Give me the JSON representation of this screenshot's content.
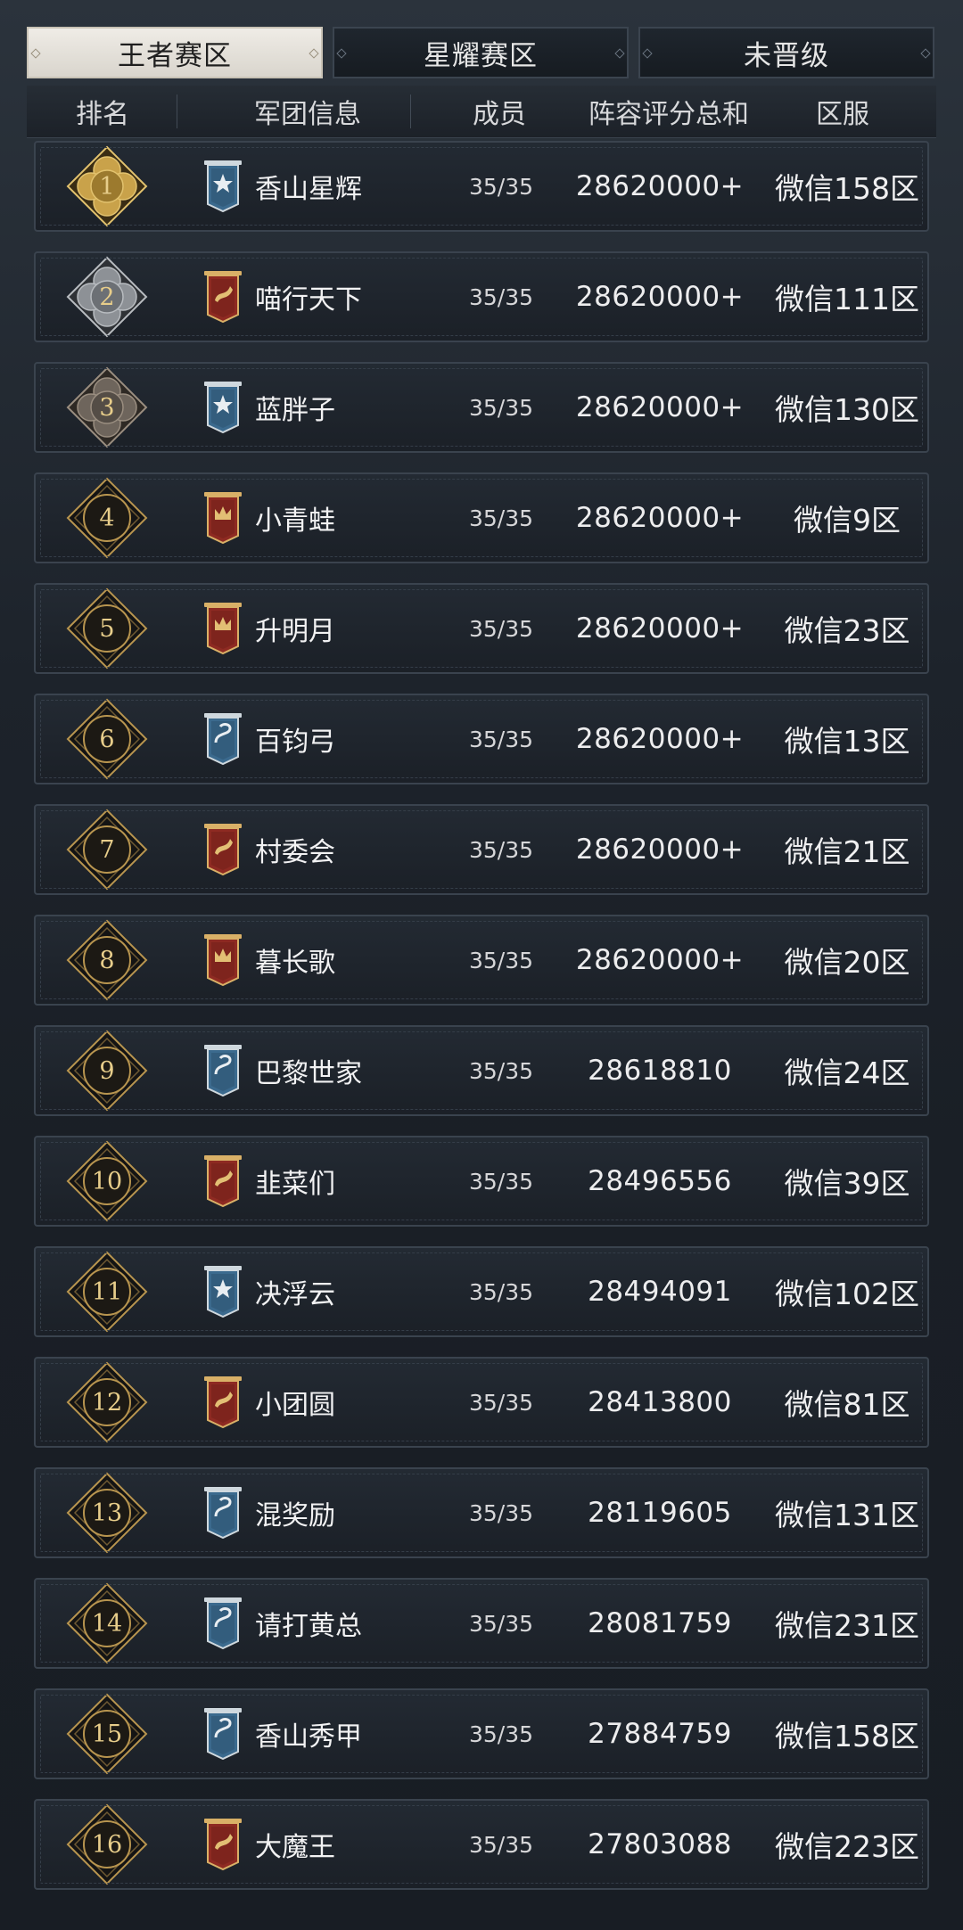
{
  "tabs": [
    {
      "label": "王者赛区",
      "active": true
    },
    {
      "label": "星耀赛区",
      "active": false
    },
    {
      "label": "未晋级",
      "active": false
    }
  ],
  "columns": {
    "rank": "排名",
    "guild": "军团信息",
    "members": "成员",
    "score": "阵容评分总和",
    "server": "区服"
  },
  "colors": {
    "gold_badge": "#c9a24a",
    "silver_badge": "#8d9196",
    "bronze_badge": "#6e655c",
    "red_banner": "#8e2a22",
    "blue_banner": "#3b6a8e"
  },
  "rows": [
    {
      "rank": "1",
      "name": "香山星辉",
      "members": "35/35",
      "score": "28620000+",
      "server": "微信158区",
      "banner": "blue-star",
      "badge": "gold"
    },
    {
      "rank": "2",
      "name": "喵行天下",
      "members": "35/35",
      "score": "28620000+",
      "server": "微信111区",
      "banner": "red-dragon",
      "badge": "silver"
    },
    {
      "rank": "3",
      "name": "蓝胖子",
      "members": "35/35",
      "score": "28620000+",
      "server": "微信130区",
      "banner": "blue-star",
      "badge": "bronze"
    },
    {
      "rank": "4",
      "name": "小青蛙",
      "members": "35/35",
      "score": "28620000+",
      "server": "微信9区",
      "banner": "red-crown",
      "badge": "dark"
    },
    {
      "rank": "5",
      "name": "升明月",
      "members": "35/35",
      "score": "28620000+",
      "server": "微信23区",
      "banner": "red-crown",
      "badge": "dark"
    },
    {
      "rank": "6",
      "name": "百钧弓",
      "members": "35/35",
      "score": "28620000+",
      "server": "微信13区",
      "banner": "blue-serpent",
      "badge": "dark"
    },
    {
      "rank": "7",
      "name": "村委会",
      "members": "35/35",
      "score": "28620000+",
      "server": "微信21区",
      "banner": "red-dragon",
      "badge": "dark"
    },
    {
      "rank": "8",
      "name": "暮长歌",
      "members": "35/35",
      "score": "28620000+",
      "server": "微信20区",
      "banner": "red-crown",
      "badge": "dark"
    },
    {
      "rank": "9",
      "name": "巴黎世家",
      "members": "35/35",
      "score": "28618810",
      "server": "微信24区",
      "banner": "blue-serpent",
      "badge": "dark"
    },
    {
      "rank": "10",
      "name": "韭菜们",
      "members": "35/35",
      "score": "28496556",
      "server": "微信39区",
      "banner": "red-dragon",
      "badge": "dark"
    },
    {
      "rank": "11",
      "name": "决浮云",
      "members": "35/35",
      "score": "28494091",
      "server": "微信102区",
      "banner": "blue-star",
      "badge": "dark"
    },
    {
      "rank": "12",
      "name": "小团圆",
      "members": "35/35",
      "score": "28413800",
      "server": "微信81区",
      "banner": "red-dragon",
      "badge": "dark"
    },
    {
      "rank": "13",
      "name": "混奖励",
      "members": "35/35",
      "score": "28119605",
      "server": "微信131区",
      "banner": "blue-serpent",
      "badge": "dark"
    },
    {
      "rank": "14",
      "name": "请打黄总",
      "members": "35/35",
      "score": "28081759",
      "server": "微信231区",
      "banner": "blue-serpent",
      "badge": "dark"
    },
    {
      "rank": "15",
      "name": "香山秀甲",
      "members": "35/35",
      "score": "27884759",
      "server": "微信158区",
      "banner": "blue-serpent",
      "badge": "dark"
    },
    {
      "rank": "16",
      "name": "大魔王",
      "members": "35/35",
      "score": "27803088",
      "server": "微信223区",
      "banner": "red-dragon",
      "badge": "dark"
    }
  ]
}
